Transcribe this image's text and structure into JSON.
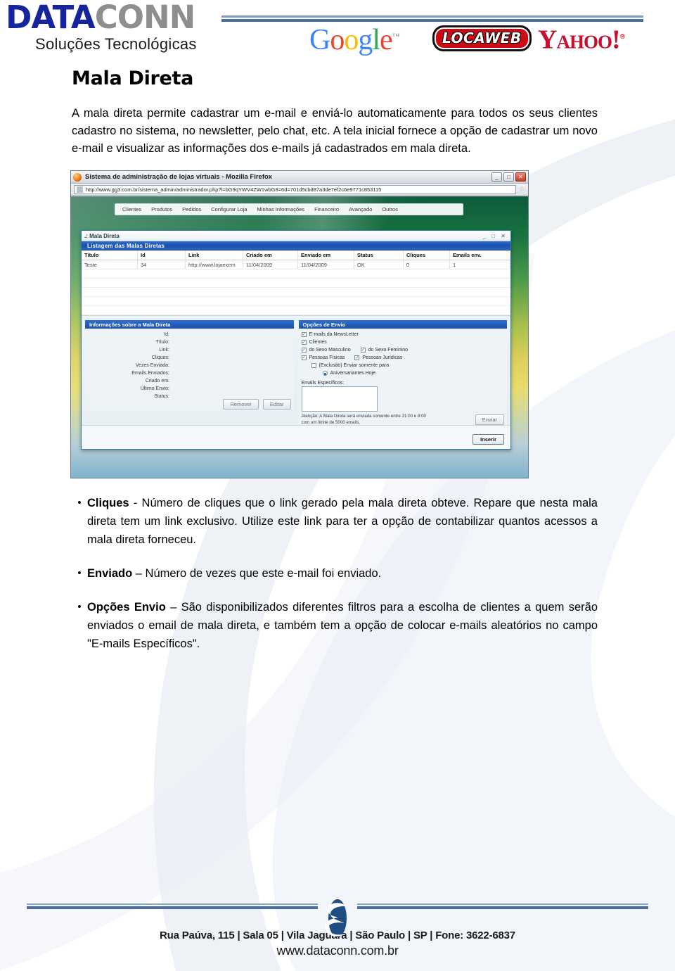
{
  "header": {
    "logo": {
      "part1": "DATA",
      "part2": "CONN",
      "tagline": "Soluções Tecnológicas"
    },
    "partners": [
      {
        "name": "google-logo",
        "label": "Google"
      },
      {
        "name": "locaweb-logo",
        "label": "LOCAWEB"
      },
      {
        "name": "yahoo-logo",
        "label": "YAHOO!"
      }
    ]
  },
  "page": {
    "title": "Mala Direta",
    "intro_p1": "A mala direta permite cadastrar um e-mail e enviá-lo automaticamente para todos os seus clientes cadastro no sistema, no newsletter, pelo chat, etc. A tela inicial fornece a opção de cadastrar um novo e-mail e visualizar as informações dos e-mails já cadastrados em mala direta."
  },
  "screenshot": {
    "browser": {
      "window_title": "Sistema de administração de lojas virtuais - Mozilla Firefox",
      "url": "http://www.gg3.com.br/sistema_admin/administrador.php?l=bG9qYWV4ZW1wbG8=6d=701d5cbd87a3de7ef2c6e9771c853115",
      "minimize": "_",
      "maximize": "□",
      "close": "✕",
      "star_icon": "☆"
    },
    "site_nav": [
      "Clientes",
      "Produtos",
      "Pedidos",
      "Configurar Loja",
      "Minhas Informações",
      "Financeiro",
      "Avançado",
      "Outros"
    ],
    "app_window": {
      "title": ".: Mala Direta",
      "controls": "_ □ ✕",
      "listing_title": "Listagem das Malas Diretas",
      "table": {
        "columns": [
          "Título",
          "Id",
          "Link",
          "Criado em",
          "Enviado em",
          "Status",
          "Cliques",
          "Emails env."
        ],
        "rows": [
          [
            "Teste",
            "34",
            "http://www.lojaexem",
            "11/04/2009",
            "11/04/2009",
            "OK",
            "0",
            "1"
          ]
        ]
      },
      "info_panel": {
        "title": "Informações sobre a Mala Direta",
        "fields": [
          "Id:",
          "Título:",
          "Link:",
          "Cliques:",
          "Vezes Enviada:",
          "Emails Enviados:",
          "Criado em:",
          "Último Envio:",
          "Status:"
        ],
        "buttons": [
          "Remover",
          "Editar"
        ]
      },
      "options_panel": {
        "title": "Opções de Envio",
        "checkboxes": [
          {
            "label": "E-mails da NewsLetter",
            "checked": true,
            "indent": 0
          },
          {
            "label": "Clientes",
            "checked": true,
            "indent": 0
          }
        ],
        "gender_row": [
          {
            "label": "do Sexo Masculino",
            "checked": true
          },
          {
            "label": "do Sexo Feminino",
            "checked": true
          }
        ],
        "person_row": [
          {
            "label": "Pessoas Físicas",
            "checked": true
          },
          {
            "label": "Pessoas Jurídicas",
            "checked": true
          }
        ],
        "exclusive": {
          "label": "(Exclusão) Enviar somente para",
          "checked": false
        },
        "radio": {
          "label": "Aniversariantes Hoje",
          "selected": true
        },
        "emails_label": "Emails Específicos:",
        "emails_value": "",
        "warning": "Atenção: A Mala Direta será enviada somente entre 21:00 e 8:00 com um limite de 5000 emails.",
        "btn_enviar": "Enviar",
        "btn_inserir": "Inserir"
      }
    }
  },
  "bullets": [
    {
      "marker": "•",
      "term": "Cliques",
      "separator": " - ",
      "text": "Número de cliques que o link gerado pela mala direta obteve. Repare que nesta mala direta tem um link exclusivo. Utilize este link para ter a opção de contabilizar quantos acessos a mala direta forneceu."
    },
    {
      "marker": "•",
      "term": "Enviado",
      "separator": " – ",
      "text": "Número de vezes que este e-mail foi enviado."
    },
    {
      "marker": "•",
      "term": "Opções Envio",
      "separator": " – ",
      "text": "São disponibilizados diferentes filtros para a escolha de clientes a quem serão enviados o email de mala direta, e também tem a opção de colocar e-mails aleatórios no campo \"E-mails Específicos\"."
    }
  ],
  "footer": {
    "address": "Rua Paúva, 115 | Sala 05 | Vila Jaguara | São Paulo | SP | Fone: 3622-6837",
    "website": "www.dataconn.com.br"
  },
  "colors": {
    "brand_blue": "#16259c",
    "brand_grey": "#8e8e8e",
    "rule_blue": "#4a6d99",
    "watermark": "#e8edf4",
    "panel_header": "#1b4fa8"
  }
}
